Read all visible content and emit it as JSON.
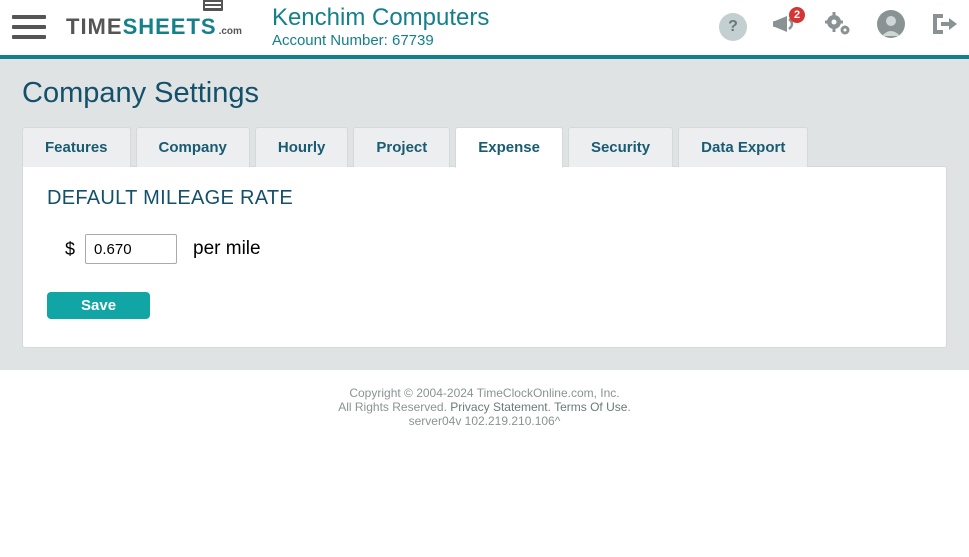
{
  "header": {
    "company_name": "Kenchim Computers",
    "account_label": "Account Number: 67739",
    "notification_count": "2",
    "help_glyph": "?"
  },
  "logo": {
    "part1": "TIME",
    "part2": "SHEETS",
    "suffix": ".com"
  },
  "page_title": "Company Settings",
  "tabs": {
    "features": "Features",
    "company": "Company",
    "hourly": "Hourly",
    "project": "Project",
    "expense": "Expense",
    "security": "Security",
    "data_export": "Data Export"
  },
  "expense": {
    "section_title": "DEFAULT MILEAGE RATE",
    "currency": "$",
    "rate_value": "0.670",
    "suffix": "per mile",
    "save_label": "Save"
  },
  "footer": {
    "copyright": "Copyright © 2004-2024 TimeClockOnline.com, Inc.",
    "rights": "All Rights Reserved. ",
    "privacy": "Privacy Statement",
    "terms": "Terms Of Use",
    "server": "server04v 102.219.210.106^",
    "dot": ". "
  }
}
